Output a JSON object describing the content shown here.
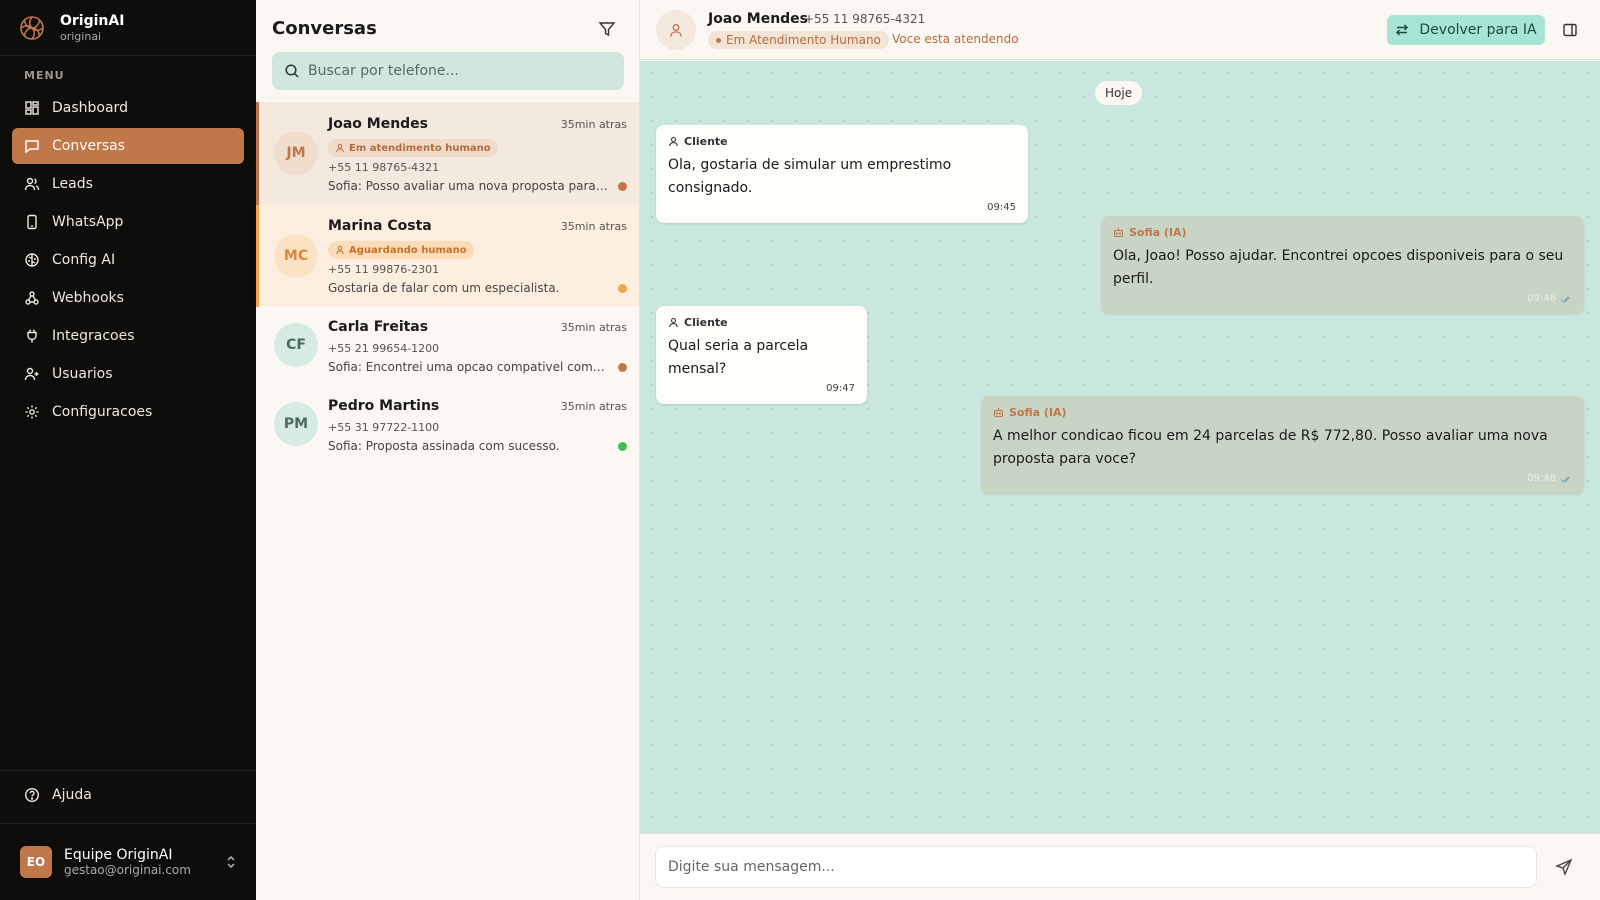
{
  "brand": {
    "name": "OriginAI",
    "sub": "originai"
  },
  "menu_label": "MENU",
  "nav": [
    {
      "label": "Dashboard",
      "icon": "dashboard-icon",
      "active": false
    },
    {
      "label": "Conversas",
      "icon": "chat-icon",
      "active": true
    },
    {
      "label": "Leads",
      "icon": "users-icon",
      "active": false
    },
    {
      "label": "WhatsApp",
      "icon": "phone-icon",
      "active": false
    },
    {
      "label": "Config AI",
      "icon": "brain-icon",
      "active": false
    },
    {
      "label": "Webhooks",
      "icon": "webhook-icon",
      "active": false
    },
    {
      "label": "Integracoes",
      "icon": "plug-icon",
      "active": false
    },
    {
      "label": "Usuarios",
      "icon": "user-plus-icon",
      "active": false
    },
    {
      "label": "Configuracoes",
      "icon": "gear-icon",
      "active": false
    }
  ],
  "help_label": "Ajuda",
  "user": {
    "initials": "EO",
    "name": "Equipe OriginAI",
    "email": "gestao@originai.com"
  },
  "conversations": {
    "title": "Conversas",
    "search_placeholder": "Buscar por telefone...",
    "items": [
      {
        "initials": "JM",
        "name": "Joao Mendes",
        "time": "35min atras",
        "badge": "Em atendimento humano",
        "phone": "+55 11 98765-4321",
        "message": "Sofia: Posso avaliar uma nova proposta para voce?",
        "dot_color": "#c0774a",
        "state": "selected"
      },
      {
        "initials": "MC",
        "name": "Marina Costa",
        "time": "35min atras",
        "badge": "Aguardando humano",
        "phone": "+55 11 99876-2301",
        "message": "Gostaria de falar com um especialista.",
        "dot_color": "#f2a44c",
        "state": "waiting"
      },
      {
        "initials": "CF",
        "name": "Carla Freitas",
        "time": "35min atras",
        "badge": "",
        "phone": "+55 21 99654-1200",
        "message": "Sofia: Encontrei uma opcao compativel com seu perfil.",
        "dot_color": "#c0774a",
        "state": "normal"
      },
      {
        "initials": "PM",
        "name": "Pedro Martins",
        "time": "35min atras",
        "badge": "",
        "phone": "+55 31 97722-1100",
        "message": "Sofia: Proposta assinada com sucesso.",
        "dot_color": "#3fbf5a",
        "state": "normal"
      }
    ]
  },
  "chat": {
    "name": "Joao Mendes",
    "phone": "+55 11 98765-4321",
    "status": "Em Atendimento Humano",
    "attending": "Voce esta atendendo",
    "return_label": "Devolver para IA",
    "date_label": "Hoje",
    "messages": [
      {
        "from": "client",
        "author": "Cliente",
        "text": "Ola, gostaria de simular um emprestimo consignado.",
        "time": "09:45"
      },
      {
        "from": "ai",
        "author": "Sofia (IA)",
        "text": "Ola, Joao! Posso ajudar. Encontrei opcoes disponiveis para o seu perfil.",
        "time": "09:46"
      },
      {
        "from": "client",
        "author": "Cliente",
        "text": "Qual seria a parcela mensal?",
        "time": "09:47"
      },
      {
        "from": "ai",
        "author": "Sofia (IA)",
        "text": "A melhor condicao ficou em 24 parcelas de R$ 772,80. Posso avaliar uma nova proposta para voce?",
        "time": "09:48"
      }
    ],
    "composer_placeholder": "Digite sua mensagem..."
  },
  "colors": {
    "accent": "#c0774a",
    "chat_bg": "#c9e7de",
    "ai_bubble": "#c8d5c5",
    "return_button": "#a8e4d3"
  }
}
